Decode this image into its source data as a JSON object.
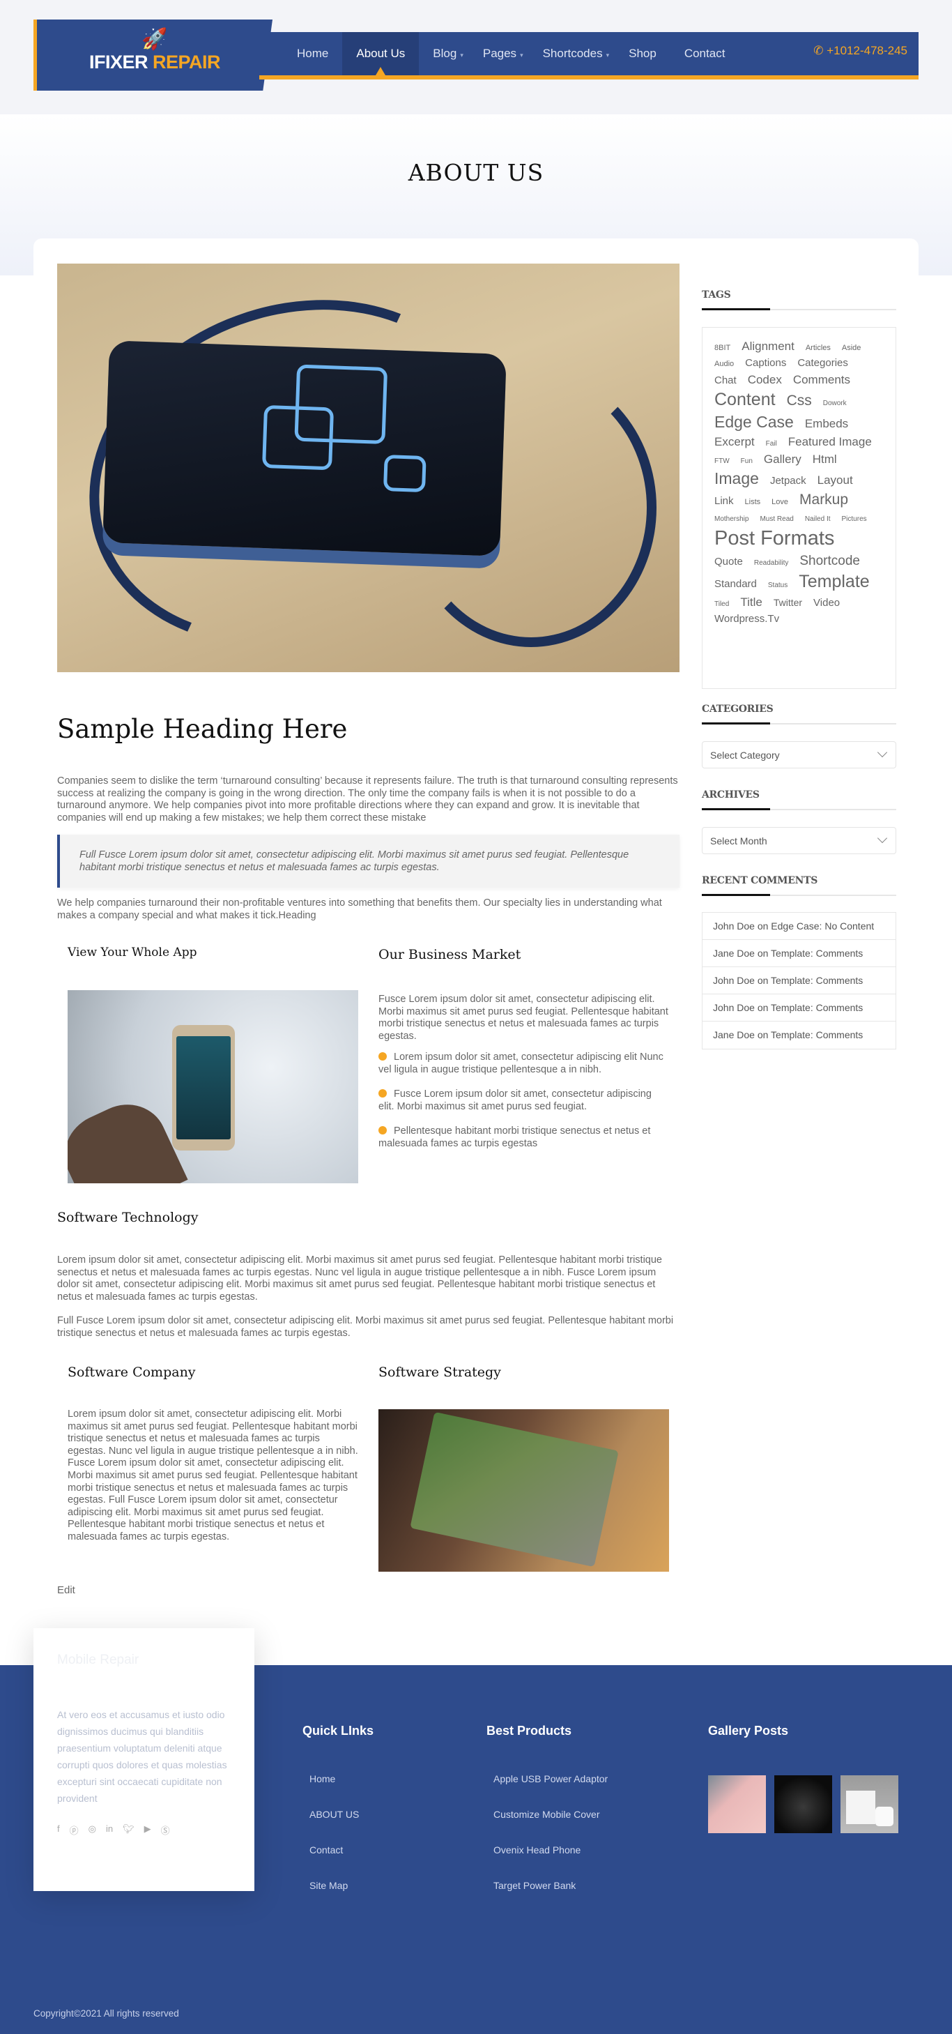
{
  "brand": {
    "name_white": "IFIXER",
    "name_orange": "REPAIR",
    "icon": "rocket-icon"
  },
  "nav": {
    "items": [
      {
        "label": "Home"
      },
      {
        "label": "About Us",
        "active": true
      },
      {
        "label": "Blog",
        "dropdown": true
      },
      {
        "label": "Pages",
        "dropdown": true
      },
      {
        "label": "Shortcodes",
        "dropdown": true
      },
      {
        "label": "Shop"
      },
      {
        "label": "Contact"
      }
    ],
    "phone": "+1012-478-245",
    "phone_icon": "phone-icon"
  },
  "page_title": "ABOUT US",
  "content": {
    "heading": "Sample Heading Here",
    "para1": "Companies seem to dislike the term ‘turnaround consulting’ because it represents failure. The truth is that turnaround consulting represents success at realizing the company is going in the wrong direction. The only time the company fails is when it is not possible to do a turnaround anymore. We help companies pivot into more profitable directions where they can expand and grow. It is inevitable that companies will end up making a few mistakes; we help them correct these mistake",
    "quote": "Full Fusce Lorem ipsum dolor sit amet, consectetur adipiscing elit. Morbi maximus sit amet purus sed feugiat. Pellentesque habitant morbi tristique senectus et netus et malesuada fames ac turpis egestas.",
    "para2": "We help companies turnaround their non-profitable ventures into something that benefits them. Our specialty lies in understanding what makes a company special and what makes it tick.Heading",
    "col_app_title": "View Your Whole App",
    "col_market_title": "Our Business Market",
    "market_text": "Fusce Lorem ipsum dolor sit amet, consectetur adipiscing elit. Morbi maximus sit amet purus sed feugiat. Pellentesque habitant morbi tristique senectus et netus et malesuada fames ac turpis egestas.",
    "bullets": [
      "Lorem ipsum dolor sit amet, consectetur adipiscing elit Nunc vel ligula in augue tristique pellentesque a in nibh.",
      "Fusce Lorem ipsum dolor sit amet, consectetur adipiscing elit. Morbi maximus sit amet purus sed feugiat.",
      "Pellentesque habitant morbi tristique senectus et netus et malesuada fames ac turpis egestas"
    ],
    "tech_title": "Software Technology",
    "tech_p1": "Lorem ipsum dolor sit amet, consectetur adipiscing elit. Morbi maximus sit amet purus sed feugiat. Pellentesque habitant morbi tristique senectus et netus et malesuada fames ac turpis egestas. Nunc vel ligula in augue tristique pellentesque a in nibh. Fusce Lorem ipsum dolor sit amet, consectetur adipiscing elit. Morbi maximus sit amet purus sed feugiat. Pellentesque habitant morbi tristique senectus et netus et malesuada fames ac turpis egestas.",
    "tech_p2": "Full Fusce Lorem ipsum dolor sit amet, consectetur adipiscing elit. Morbi maximus sit amet purus sed feugiat. Pellentesque habitant morbi tristique senectus et netus et malesuada fames ac turpis egestas.",
    "company_title": "Software Company",
    "company_text": "Lorem ipsum dolor sit amet, consectetur adipiscing elit. Morbi maximus sit amet purus sed feugiat. Pellentesque habitant morbi tristique senectus et netus et malesuada fames ac turpis egestas. Nunc vel ligula in augue tristique pellentesque a in nibh. Fusce Lorem ipsum dolor sit amet, consectetur adipiscing elit. Morbi maximus sit amet purus sed feugiat. Pellentesque habitant morbi tristique senectus et netus et malesuada fames ac turpis egestas. Full Fusce Lorem ipsum dolor sit amet, consectetur adipiscing elit. Morbi maximus sit amet purus sed feugiat. Pellentesque habitant morbi tristique senectus et netus et malesuada fames ac turpis egestas.",
    "strategy_title": "Software Strategy",
    "edit": "Edit"
  },
  "sidebar": {
    "tags_title": "TAGS",
    "tags": [
      {
        "t": "8BIT",
        "s": 11
      },
      {
        "t": "Alignment",
        "s": 17
      },
      {
        "t": "Articles",
        "s": 11
      },
      {
        "t": "Aside",
        "s": 11
      },
      {
        "t": "Audio",
        "s": 11
      },
      {
        "t": "Captions",
        "s": 15
      },
      {
        "t": "Categories",
        "s": 15
      },
      {
        "t": "Chat",
        "s": 15
      },
      {
        "t": "Codex",
        "s": 17
      },
      {
        "t": "Comments",
        "s": 17
      },
      {
        "t": "Content",
        "s": 25
      },
      {
        "t": "Css",
        "s": 21
      },
      {
        "t": "Dowork",
        "s": 10
      },
      {
        "t": "Edge Case",
        "s": 23
      },
      {
        "t": "Embeds",
        "s": 17
      },
      {
        "t": "Excerpt",
        "s": 17
      },
      {
        "t": "Fail",
        "s": 10
      },
      {
        "t": "Featured Image",
        "s": 17
      },
      {
        "t": "FTW",
        "s": 10
      },
      {
        "t": "Fun",
        "s": 10
      },
      {
        "t": "Gallery",
        "s": 17
      },
      {
        "t": "Html",
        "s": 17
      },
      {
        "t": "Image",
        "s": 23
      },
      {
        "t": "Jetpack",
        "s": 15
      },
      {
        "t": "Layout",
        "s": 17
      },
      {
        "t": "Link",
        "s": 15
      },
      {
        "t": "Lists",
        "s": 11
      },
      {
        "t": "Love",
        "s": 11
      },
      {
        "t": "Markup",
        "s": 21
      },
      {
        "t": "Mothership",
        "s": 10
      },
      {
        "t": "Must Read",
        "s": 10
      },
      {
        "t": "Nailed It",
        "s": 10
      },
      {
        "t": "Pictures",
        "s": 10
      },
      {
        "t": "Post Formats",
        "s": 29
      },
      {
        "t": "Quote",
        "s": 15
      },
      {
        "t": "Readability",
        "s": 10
      },
      {
        "t": "Shortcode",
        "s": 19
      },
      {
        "t": "Standard",
        "s": 15
      },
      {
        "t": "Status",
        "s": 10
      },
      {
        "t": "Template",
        "s": 25
      },
      {
        "t": "Tiled",
        "s": 10
      },
      {
        "t": "Title",
        "s": 17
      },
      {
        "t": "Twitter",
        "s": 14
      },
      {
        "t": "Video",
        "s": 15
      },
      {
        "t": "Wordpress.Tv",
        "s": 15
      }
    ],
    "categories_title": "CATEGORIES",
    "categories_select": "Select Category",
    "archives_title": "ARCHIVES",
    "archives_select": "Select Month",
    "recent_title": "RECENT COMMENTS",
    "comments": [
      "John Doe on Edge Case: No Content",
      "Jane Doe on Template: Comments",
      "John Doe on Template: Comments",
      "John Doe on Template: Comments",
      "Jane Doe on Template: Comments"
    ]
  },
  "footer": {
    "about_title": "Mobile Repair",
    "about_text": "At vero eos et accusamus et iusto odio dignissimos ducimus qui blanditiis praesentium voluptatum deleniti atque corrupti quos dolores et quas molestias excepturi sint occaecati cupiditate non provident",
    "social": [
      "facebook-icon",
      "pinterest-icon",
      "instagram-icon",
      "linkedin-icon",
      "twitter-icon",
      "youtube-icon",
      "skype-icon"
    ],
    "quick_title": "Quick LInks",
    "quick_links": [
      "Home",
      "ABOUT US",
      "Contact",
      "Site Map"
    ],
    "products_title": "Best Products",
    "products": [
      "Apple USB Power Adaptor",
      "Customize Mobile Cover",
      "Ovenix Head Phone",
      "Target Power Bank"
    ],
    "gallery_title": "Gallery Posts",
    "copyright": "Copyright©2021 All rights reserved"
  },
  "colors": {
    "primary": "#2e4b8c",
    "accent": "#f5a623",
    "active_nav": "#263f78"
  }
}
